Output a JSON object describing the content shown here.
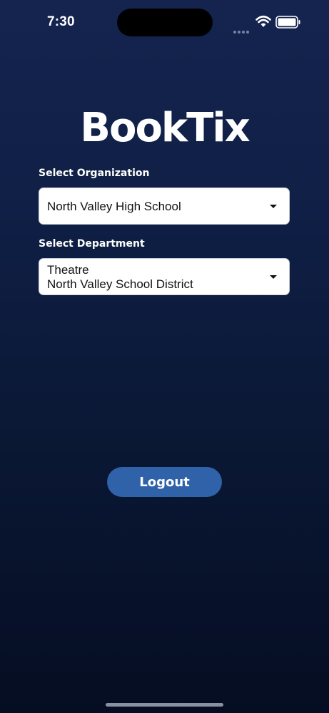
{
  "status_bar": {
    "time": "7:30"
  },
  "app": {
    "title": "BookTix"
  },
  "organization": {
    "label": "Select Organization",
    "selected": "North Valley High School"
  },
  "department": {
    "label": "Select Department",
    "selected_line1": "Theatre",
    "selected_line2": "North Valley School District"
  },
  "actions": {
    "logout_label": "Logout"
  },
  "colors": {
    "background_top": "#14244f",
    "background_bottom": "#050d22",
    "button": "#2f62a8",
    "field": "#ffffff"
  },
  "icons": {
    "status": [
      "cellular-icon",
      "wifi-icon",
      "battery-icon"
    ],
    "dropdown": "caret-down-icon"
  }
}
